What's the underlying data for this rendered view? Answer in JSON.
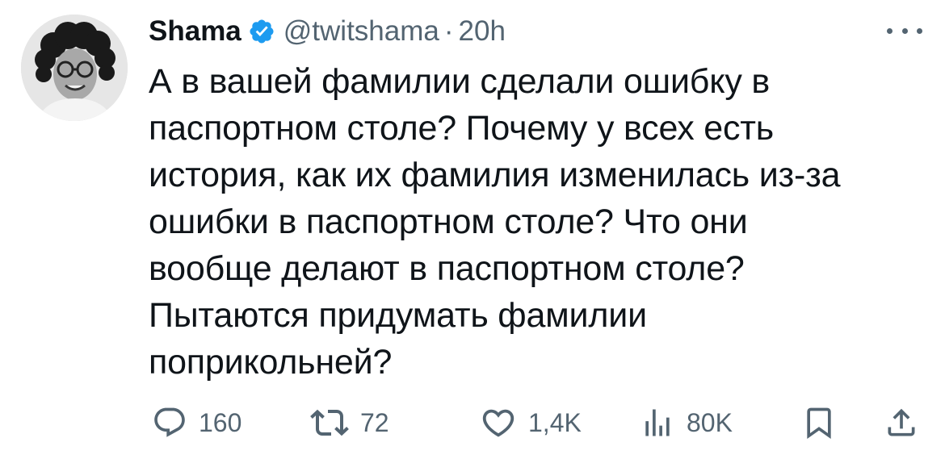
{
  "author": {
    "name": "Shama",
    "handle": "@twitshama",
    "separator": "·",
    "time": "20h"
  },
  "icons": {
    "verified": "verified-badge-icon",
    "more": "more-options-icon",
    "reply": "reply-icon",
    "retweet": "retweet-icon",
    "like": "like-icon",
    "views": "views-icon",
    "bookmark": "bookmark-icon",
    "share": "share-icon"
  },
  "colors": {
    "verified": "#1d9bf0",
    "text": "#0f1419",
    "secondary": "#536471"
  },
  "tweet": {
    "text": "А в вашей фамилии сделали ошибку в\nпаспортном столе? Почему у всех есть\nистория, как их фамилия изменилась из-за\nошибки в паспортном столе? Что они\nвообще делают в паспортном столе?\nПытаются придумать фамилии\nпоприкольней?"
  },
  "metrics": {
    "replies": "160",
    "retweets": "72",
    "likes": "1,4K",
    "views": "80K"
  }
}
